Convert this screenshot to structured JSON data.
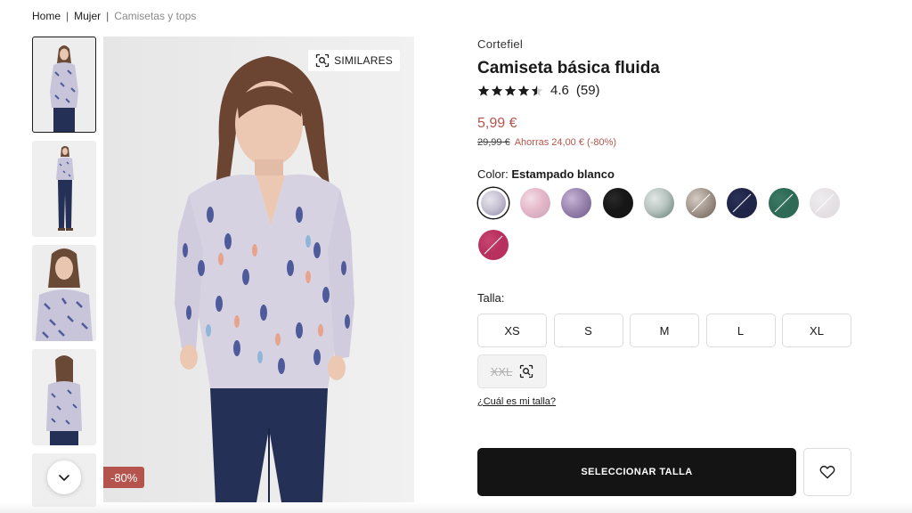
{
  "breadcrumb": {
    "items": [
      "Home",
      "Mujer",
      "Camisetas y tops"
    ],
    "separator": "|"
  },
  "gallery": {
    "similar_label": "SIMILARES",
    "discount_badge": "-80%"
  },
  "product": {
    "brand": "Cortefiel",
    "title": "Camiseta básica fluida",
    "rating": {
      "value": "4.6",
      "count": "(59)",
      "stars_filled": 4.5
    },
    "price": "5,99 €",
    "old_price": "29,99 €",
    "savings": "Ahorras 24,00 € (-80%)"
  },
  "color": {
    "label": "Color:",
    "selected_name": "Estampado blanco",
    "swatches": [
      {
        "name": "estampado-blanco",
        "colors": [
          "#c9c4d4",
          "#8e88a8",
          "#e8e4ee"
        ],
        "selected": true,
        "unavailable": false
      },
      {
        "name": "estampado-rosa",
        "colors": [
          "#e4b8c8",
          "#c9a0bd",
          "#f3dde6"
        ],
        "selected": false,
        "unavailable": false
      },
      {
        "name": "estampado-malva",
        "colors": [
          "#9b86b0",
          "#6e5a8a",
          "#c6b4d6"
        ],
        "selected": false,
        "unavailable": false
      },
      {
        "name": "negro",
        "colors": [
          "#161616",
          "#161616",
          "#2a2a2a"
        ],
        "selected": false,
        "unavailable": false
      },
      {
        "name": "estampado-verde",
        "colors": [
          "#b8c4c0",
          "#5e7a72",
          "#e2e6e4"
        ],
        "selected": false,
        "unavailable": false
      },
      {
        "name": "estampado-marron",
        "colors": [
          "#a69a90",
          "#6a5c52",
          "#d6ccc4"
        ],
        "selected": false,
        "unavailable": true
      },
      {
        "name": "azul-marino",
        "colors": [
          "#1f2547",
          "#1f2547",
          "#2b3158"
        ],
        "selected": false,
        "unavailable": true
      },
      {
        "name": "verde",
        "colors": [
          "#2e6a56",
          "#2e6a56",
          "#3b7a64"
        ],
        "selected": false,
        "unavailable": true
      },
      {
        "name": "gris-claro",
        "colors": [
          "#e6e2e6",
          "#dcd8dc",
          "#efecef"
        ],
        "selected": false,
        "unavailable": true
      },
      {
        "name": "fucsia",
        "colors": [
          "#b8315e",
          "#b8315e",
          "#c84572"
        ],
        "selected": false,
        "unavailable": true
      }
    ]
  },
  "size": {
    "label": "Talla:",
    "options": [
      {
        "label": "XS",
        "available": true
      },
      {
        "label": "S",
        "available": true
      },
      {
        "label": "M",
        "available": true
      },
      {
        "label": "L",
        "available": true
      },
      {
        "label": "XL",
        "available": true
      },
      {
        "label": "XXL",
        "available": false
      }
    ],
    "guide_link": "¿Cuál es mi talla?"
  },
  "actions": {
    "add_label": "SELECCIONAR TALLA"
  },
  "icons": [
    "search-similar-icon",
    "chevron-down-icon",
    "star-icon",
    "heart-icon"
  ]
}
